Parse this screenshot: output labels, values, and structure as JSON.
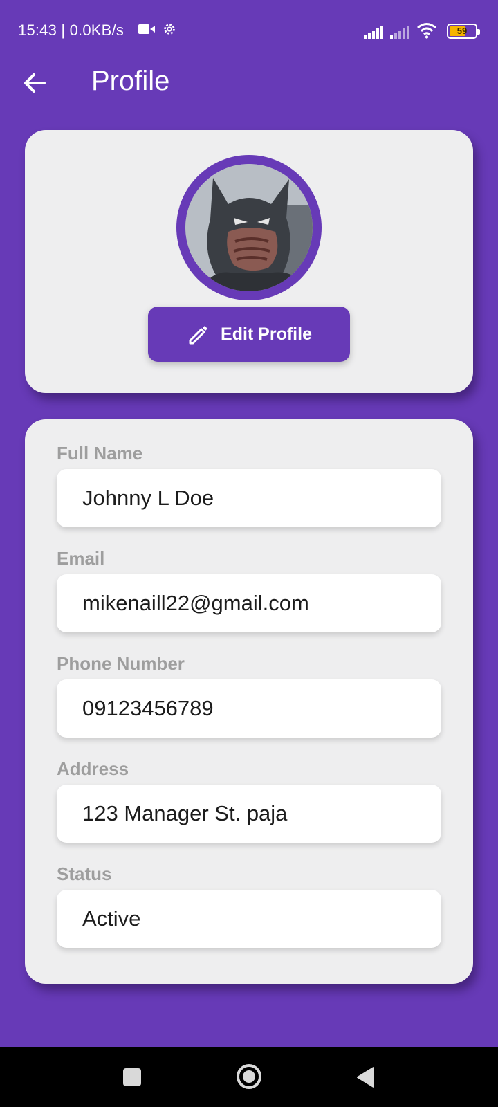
{
  "status_bar": {
    "time_and_speed": "15:43 | 0.0KB/s",
    "battery_level": "59"
  },
  "app_bar": {
    "title": "Profile"
  },
  "profile_card": {
    "avatar_alt": "Profile photo",
    "edit_button_label": "Edit Profile"
  },
  "fields": [
    {
      "label": "Full Name",
      "value": "Johnny L Doe"
    },
    {
      "label": "Email",
      "value": "mikenaill22@gmail.com"
    },
    {
      "label": "Phone Number",
      "value": "09123456789"
    },
    {
      "label": "Address",
      "value": "123 Manager St. paja"
    },
    {
      "label": "Status",
      "value": "Active"
    }
  ],
  "colors": {
    "primary": "#673ab7",
    "card": "#eeeeef",
    "label": "#9e9e9e",
    "battery": "#f5b400"
  },
  "icons": {
    "back": "arrow-left-icon",
    "edit": "pencil-icon",
    "nav_recents": "square-icon",
    "nav_home": "circle-icon",
    "nav_back": "triangle-back-icon"
  }
}
